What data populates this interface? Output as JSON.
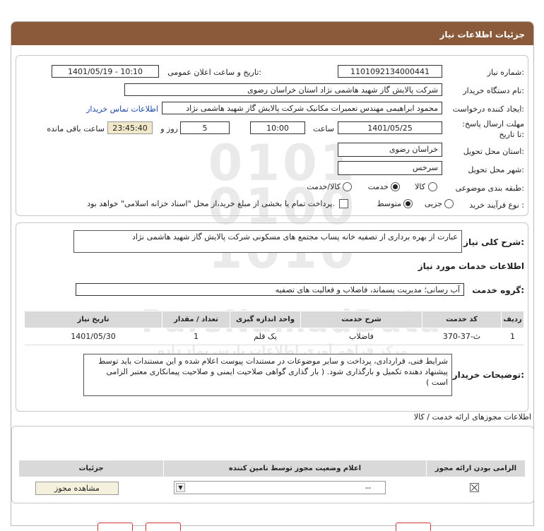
{
  "header": {
    "title": "جزئیات اطلاعات نیاز"
  },
  "fields": {
    "need_number_label": "شماره نیاز:",
    "need_number": "1101092134000441",
    "announce_label": "تاریخ و ساعت اعلان عمومی:",
    "announce_value": "1401/05/19 - 10:10",
    "buyer_label": "نام دستگاه خریدار:",
    "buyer_value": "شرکت پالایش گاز شهید هاشمی نژاد   استان خراسان رضوی",
    "creator_label": "ایجاد کننده درخواست:",
    "creator_value": "محمود ابراهیمی مهندس تعمیرات مکانیک شرکت پالایش گاز شهید هاشمی نژاد",
    "contact_link": "اطلاعات تماس خریدار",
    "deadline_label": "مهلت ارسال پاسخ: تا تاریخ:",
    "deadline_date": "1401/05/25",
    "time_label": "ساعت",
    "deadline_time": "10:00",
    "days_value": "5",
    "days_label": "روز و",
    "remaining_time": "23:45:40",
    "remaining_label": "ساعت باقی مانده",
    "province_label": "استان محل تحویل:",
    "province_value": "خراسان رضوی",
    "city_label": "شهر محل تحویل:",
    "city_value": "سرخس",
    "category_label": "طبقه بندی موضوعی:",
    "category_options": [
      "کالا",
      "خدمت",
      "کالا/خدمت"
    ],
    "process_label": "نوع فرآیند خرید :",
    "process_options": [
      "جزیی",
      "متوسط"
    ],
    "payment_note": "پرداخت تمام یا بخشی از مبلغ خرید،از محل \"اسناد خزانه اسلامی\" خواهد بود."
  },
  "summary": {
    "label": "شرح کلی نیاز:",
    "text": "عبارت از بهره برداری از تصفیه خانه پساب مجتمع های مسکونی شرکت پالایش گاز شهید هاشمی نژاد"
  },
  "services": {
    "section_title": "اطلاعات خدمات مورد نیاز",
    "group_label": "گروه خدمت:",
    "group_value": "آب رسانی؛ مدیریت پسماند، فاضلاب و فعالیت های تصفیه",
    "table": {
      "headers": [
        "ردیف",
        "کد خدمت",
        "شرح خدمت",
        "واحد اندازه گیری",
        "تعداد / مقدار",
        "تاریخ نیاز"
      ],
      "rows": [
        [
          "1",
          "ث-37-370",
          "فاضلاب",
          "یک قلم",
          "1",
          "1401/05/30"
        ]
      ]
    }
  },
  "buyer_notes": {
    "label": "توضیحات خریدار:",
    "text": "شرایط فنی، قراردادی، پرداخت و سایر موضوعات در مستندات پیوست اعلام شده و این مستندات باید توسط پیشنهاد دهنده تکمیل و  بارگذاری شود. ( بار گذاری گواهی صلاحیت ایمنی و صلاحیت پیمانکاری معتبر الزامی است )"
  },
  "permits": {
    "section_title": "اطلاعات مجوزهای ارائه خدمت / کالا",
    "headers": [
      "الزامی بودن ارائه مجوز",
      "اعلام وضعیت مجوز توسط نامین کننده",
      "جزئیات"
    ],
    "status_value": "--",
    "view_button": "مشاهده مجوز"
  },
  "watermark": {
    "number": "010101001010",
    "brand": "ParsNamadData",
    "sub1": "مرکز فراهم آوری اطلاعات پارس نماد داده",
    "sub2": "پایگاه اطلاع رسانی مناقصه ومزایده"
  }
}
